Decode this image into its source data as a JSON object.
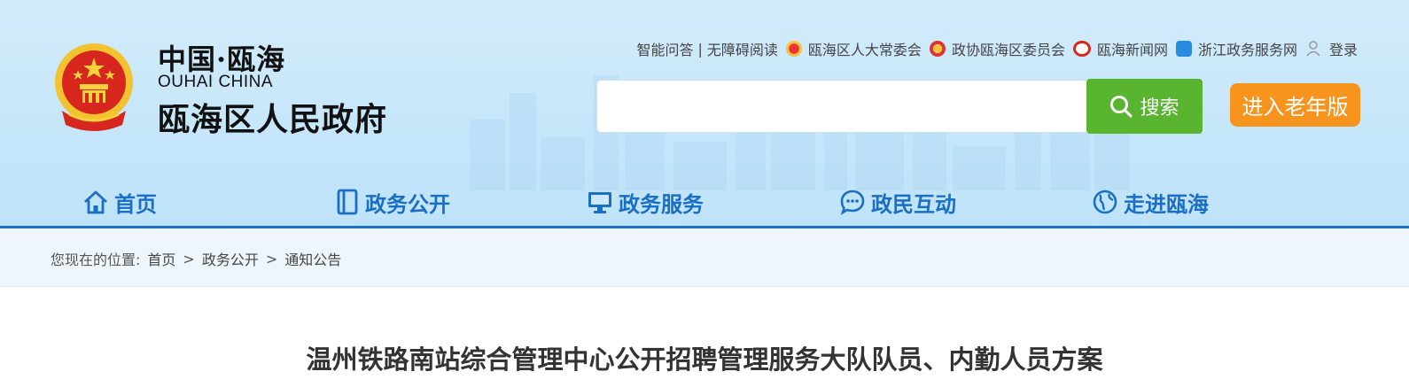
{
  "header": {
    "logo_small": "中国·瓯海",
    "logo_en": "OUHAI CHINA",
    "logo_big": "瓯海区人民政府"
  },
  "toplinks": {
    "qa": "智能问答",
    "separator": "|",
    "accessible": "无障碍阅读",
    "npc": "瓯海区人大常委会",
    "cppcc": "政协瓯海区委员会",
    "news": "瓯海新闻网",
    "zj": "浙江政务服务网",
    "login": "登录"
  },
  "search": {
    "placeholder": "",
    "button": "搜索"
  },
  "elder_button": "进入老年版",
  "nav": [
    {
      "label": "首页",
      "icon": "home-icon"
    },
    {
      "label": "政务公开",
      "icon": "book-icon"
    },
    {
      "label": "政务服务",
      "icon": "monitor-icon"
    },
    {
      "label": "政民互动",
      "icon": "chat-icon"
    },
    {
      "label": "走进瓯海",
      "icon": "globe-icon"
    }
  ],
  "breadcrumb": {
    "prefix": "您现在的位置:",
    "items": [
      "首页",
      "政务公开",
      "通知公告"
    ],
    "separator": ">"
  },
  "article": {
    "title": "温州铁路南站综合管理中心公开招聘管理服务大队队员、内勤人员方案"
  },
  "colors": {
    "nav": "#1a6fc4",
    "search_button": "#59b52f",
    "elder_button": "#f7941d",
    "accent_border": "#1a73c8"
  }
}
